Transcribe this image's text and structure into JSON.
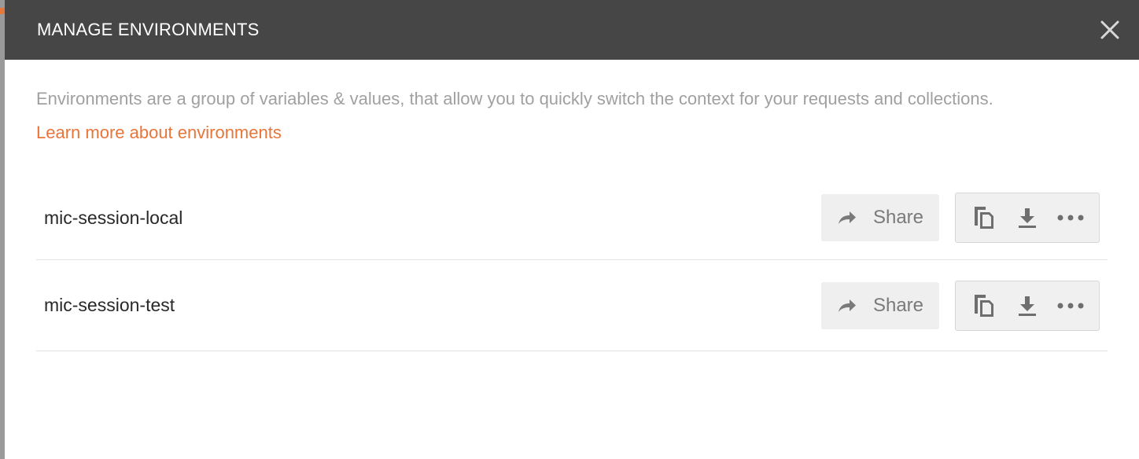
{
  "modal": {
    "title": "MANAGE ENVIRONMENTS",
    "close_icon": "close-icon",
    "description": "Environments are a group of variables & values, that allow you to quickly switch the context for your requests and collections.",
    "learn_more": "Learn more about environments"
  },
  "environments": [
    {
      "name": "mic-session-local",
      "share_label": "Share"
    },
    {
      "name": "mic-session-test",
      "share_label": "Share"
    }
  ],
  "icons": {
    "share": "share-arrow-icon",
    "duplicate": "duplicate-icon",
    "download": "download-icon",
    "more": "more-options-icon"
  },
  "colors": {
    "header_bg": "#464646",
    "accent": "#e8753a",
    "muted_text": "#a0a0a0",
    "button_bg": "#efefef"
  }
}
